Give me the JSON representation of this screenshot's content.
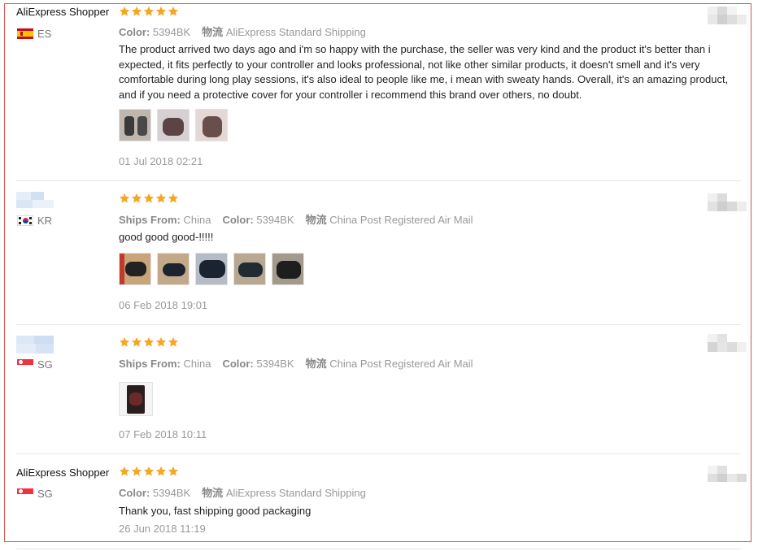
{
  "labels": {
    "color": "Color:",
    "logistics": "物流",
    "ships_from": "Ships From:"
  },
  "colors": {
    "star": "#f5a623",
    "frame": "#d9534f"
  },
  "reviews": [
    {
      "user": "AliExpress Shopper",
      "country": "ES",
      "rating": 5,
      "ships_from": "",
      "color": "5394BK",
      "logistics": "AliExpress Standard Shipping",
      "text": "The product arrived two days ago and i'm so happy with the purchase, the seller was very kind and the product it's better than i expected, it fits perfectly to your controller and looks professional, not like other similar products, it doesn't smell and it's very comfortable during long play sessions, it's also ideal to people like me, i mean with sweaty hands. Overall, it's an amazing product, and if you need a protective cover for your controller i recommend this brand over others, no doubt.",
      "photo_count": 3,
      "date": "01 Jul 2018 02:21"
    },
    {
      "user": "",
      "country": "KR",
      "rating": 5,
      "ships_from": "China",
      "color": "5394BK",
      "logistics": "China Post Registered Air Mail",
      "text": "good good good-!!!!!",
      "photo_count": 5,
      "date": "06 Feb 2018 19:01"
    },
    {
      "user": "",
      "country": "SG",
      "rating": 5,
      "ships_from": "China",
      "color": "5394BK",
      "logistics": "China Post Registered Air Mail",
      "text": "",
      "photo_count": 1,
      "date": "07 Feb 2018 10:11"
    },
    {
      "user": "AliExpress Shopper",
      "country": "SG",
      "rating": 5,
      "ships_from": "",
      "color": "5394BK",
      "logistics": "AliExpress Standard Shipping",
      "text": "Thank you, fast shipping good packaging",
      "photo_count": 0,
      "date": "26 Jun 2018 11:19"
    }
  ]
}
